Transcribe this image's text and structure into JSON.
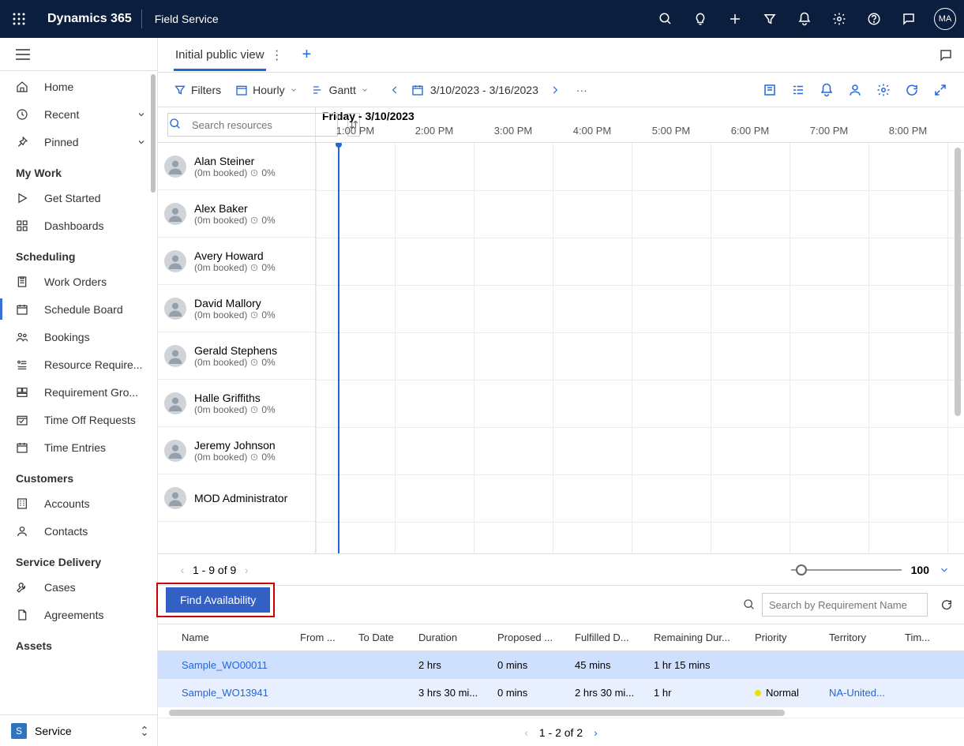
{
  "topbar": {
    "brand": "Dynamics 365",
    "app": "Field Service",
    "avatar": "MA"
  },
  "nav": {
    "top": [
      {
        "icon": "home",
        "label": "Home"
      },
      {
        "icon": "clock",
        "label": "Recent",
        "chevron": true
      },
      {
        "icon": "pin",
        "label": "Pinned",
        "chevron": true
      }
    ],
    "sections": [
      {
        "title": "My Work",
        "items": [
          {
            "icon": "play",
            "label": "Get Started"
          },
          {
            "icon": "dash",
            "label": "Dashboards"
          }
        ]
      },
      {
        "title": "Scheduling",
        "items": [
          {
            "icon": "clip",
            "label": "Work Orders"
          },
          {
            "icon": "cal",
            "label": "Schedule Board",
            "selected": true
          },
          {
            "icon": "ppl",
            "label": "Bookings"
          },
          {
            "icon": "reqlist",
            "label": "Resource Require..."
          },
          {
            "icon": "reqgrp",
            "label": "Requirement Gro..."
          },
          {
            "icon": "timeoff",
            "label": "Time Off Requests"
          },
          {
            "icon": "timeent",
            "label": "Time Entries"
          }
        ]
      },
      {
        "title": "Customers",
        "items": [
          {
            "icon": "acct",
            "label": "Accounts"
          },
          {
            "icon": "contact",
            "label": "Contacts"
          }
        ]
      },
      {
        "title": "Service Delivery",
        "items": [
          {
            "icon": "wrench",
            "label": "Cases"
          },
          {
            "icon": "doc",
            "label": "Agreements"
          }
        ]
      },
      {
        "title": "Assets",
        "items": []
      }
    ],
    "area_badge": "S",
    "area": "Service"
  },
  "tab": {
    "title": "Initial public view"
  },
  "toolbar": {
    "filters": "Filters",
    "hourly": "Hourly",
    "gantt": "Gantt",
    "range": "3/10/2023 - 3/16/2023"
  },
  "board": {
    "search_placeholder": "Search resources",
    "day_label": "Friday - 3/10/2023",
    "hours": [
      "1:00 PM",
      "2:00 PM",
      "3:00 PM",
      "4:00 PM",
      "5:00 PM",
      "6:00 PM",
      "7:00 PM",
      "8:00 PM"
    ],
    "resources": [
      {
        "name": "Alan Steiner",
        "meta": "(0m booked)",
        "pct": "0%"
      },
      {
        "name": "Alex Baker",
        "meta": "(0m booked)",
        "pct": "0%"
      },
      {
        "name": "Avery Howard",
        "meta": "(0m booked)",
        "pct": "0%"
      },
      {
        "name": "David Mallory",
        "meta": "(0m booked)",
        "pct": "0%"
      },
      {
        "name": "Gerald Stephens",
        "meta": "(0m booked)",
        "pct": "0%"
      },
      {
        "name": "Halle Griffiths",
        "meta": "(0m booked)",
        "pct": "0%"
      },
      {
        "name": "Jeremy Johnson",
        "meta": "(0m booked)",
        "pct": "0%"
      },
      {
        "name": "MOD Administrator",
        "meta": "",
        "pct": ""
      }
    ],
    "pager": "1 - 9 of 9",
    "zoom": "100"
  },
  "bottom": {
    "find": "Find Availability",
    "search_placeholder": "Search by Requirement Name",
    "columns": [
      "Name",
      "From ...",
      "To Date",
      "Duration",
      "Proposed ...",
      "Fulfilled D...",
      "Remaining Dur...",
      "Priority",
      "Territory",
      "Tim..."
    ],
    "rows": [
      {
        "name": "Sample_WO00011",
        "from": "",
        "to": "",
        "dur": "2 hrs",
        "prop": "0 mins",
        "ful": "45 mins",
        "rem": "1 hr 15 mins",
        "pri": "",
        "ter": "",
        "sel": true
      },
      {
        "name": "Sample_WO13941",
        "from": "",
        "to": "",
        "dur": "3 hrs 30 mi...",
        "prop": "0 mins",
        "ful": "2 hrs 30 mi...",
        "rem": "1 hr",
        "pri": "Normal",
        "ter": "NA-United...",
        "sel": false
      }
    ],
    "pager": "1 - 2 of 2"
  }
}
